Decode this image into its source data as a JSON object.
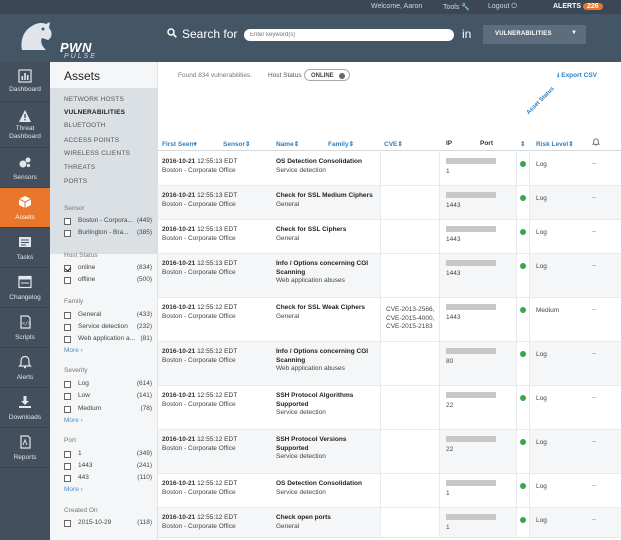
{
  "topbar": {
    "welcome": "Welcome, Aaron",
    "tools": "Tools",
    "logout": "Logout",
    "alerts_label": "ALERTS",
    "alerts_count": "226"
  },
  "brand": {
    "logo_main": "PWN",
    "logo_sub": "PULSE"
  },
  "search": {
    "label": "Search for",
    "placeholder": "Enter keyword(s)",
    "in_label": "in",
    "scope": "VULNERABILITIES"
  },
  "nav": [
    {
      "label": "Dashboard",
      "icon": "bar-chart-icon"
    },
    {
      "label": "Threat Dashboard",
      "icon": "warning-icon"
    },
    {
      "label": "Sensors",
      "icon": "sensors-icon"
    },
    {
      "label": "Assets",
      "icon": "cube-icon",
      "active": true
    },
    {
      "label": "Tasks",
      "icon": "tasks-icon"
    },
    {
      "label": "Changelog",
      "icon": "changelog-icon"
    },
    {
      "label": "Scripts",
      "icon": "script-icon"
    },
    {
      "label": "Alerts",
      "icon": "bell-icon"
    },
    {
      "label": "Downloads",
      "icon": "download-icon"
    },
    {
      "label": "Reports",
      "icon": "report-icon"
    }
  ],
  "assets": {
    "title": "Assets",
    "menu": [
      "NETWORK HOSTS",
      "VULNERABILITIES",
      "BLUETOOTH",
      "ACCESS POINTS",
      "WIRELESS CLIENTS",
      "THREATS",
      "PORTS"
    ],
    "selected": "VULNERABILITIES",
    "filters": {
      "sensor": {
        "title": "Sensor",
        "items": [
          {
            "name": "Boston - Corpora...",
            "count": "(449)",
            "checked": false
          },
          {
            "name": "Burlington - Bra...",
            "count": "(385)",
            "checked": false
          }
        ]
      },
      "host_status": {
        "title": "Host Status",
        "items": [
          {
            "name": "online",
            "count": "(834)",
            "checked": true
          },
          {
            "name": "offline",
            "count": "(500)",
            "checked": false
          }
        ]
      },
      "family": {
        "title": "Family",
        "items": [
          {
            "name": "General",
            "count": "(433)",
            "checked": false
          },
          {
            "name": "Service detection",
            "count": "(232)",
            "checked": false
          },
          {
            "name": "Web application a...",
            "count": "(81)",
            "checked": false
          }
        ],
        "more": "More"
      },
      "severity": {
        "title": "Severity",
        "items": [
          {
            "name": "Log",
            "count": "(614)",
            "checked": false
          },
          {
            "name": "Low",
            "count": "(141)",
            "checked": false
          },
          {
            "name": "Medium",
            "count": "(78)",
            "checked": false
          }
        ],
        "more": "More"
      },
      "port": {
        "title": "Port",
        "items": [
          {
            "name": "1",
            "count": "(349)",
            "checked": false
          },
          {
            "name": "1443",
            "count": "(241)",
            "checked": false
          },
          {
            "name": "443",
            "count": "(110)",
            "checked": false
          }
        ],
        "more": "More"
      },
      "created": {
        "title": "Created On",
        "items": [
          {
            "name": "2015-10-29",
            "count": "(118)",
            "checked": false
          }
        ]
      }
    }
  },
  "main": {
    "found": "Found 834 vulnerabilities.",
    "host_status_label": "Host Status",
    "host_status_value": "ONLINE",
    "export": "Export CSV",
    "asset_status_label": "Asset Status",
    "columns": {
      "first_seen": "First Seen",
      "sensor": "Sensor",
      "name": "Name",
      "family": "Family",
      "cve": "CVE",
      "ip": "IP",
      "port": "Port",
      "risk": "Risk Level"
    },
    "rows": [
      {
        "date": "2016-10-21",
        "time": "12:55:13 EDT",
        "sensor": "Boston - Corporate Office",
        "name": "OS Detection Consolidation",
        "family": "Service detection",
        "cve": "",
        "port": "1",
        "risk": "Log"
      },
      {
        "date": "2016-10-21",
        "time": "12:55:13 EDT",
        "sensor": "Boston - Corporate Office",
        "name": "Check for SSL Medium Ciphers",
        "family": "General",
        "cve": "",
        "port": "1443",
        "risk": "Log"
      },
      {
        "date": "2016-10-21",
        "time": "12:55:13 EDT",
        "sensor": "Boston - Corporate Office",
        "name": "Check for SSL Ciphers",
        "family": "General",
        "cve": "",
        "port": "1443",
        "risk": "Log"
      },
      {
        "date": "2016-10-21",
        "time": "12:55:13 EDT",
        "sensor": "Boston - Corporate Office",
        "name": "Info / Options concerning CGI Scanning",
        "family": "Web application abuses",
        "cve": "",
        "port": "1443",
        "risk": "Log"
      },
      {
        "date": "2016-10-21",
        "time": "12:55:12 EDT",
        "sensor": "Boston - Corporate Office",
        "name": "Check for SSL Weak Ciphers",
        "family": "General",
        "cve": "CVE-2013-2566, CVE-2015-4000, CVE-2015-2183",
        "port": "1443",
        "risk": "Medium"
      },
      {
        "date": "2016-10-21",
        "time": "12:55:12 EDT",
        "sensor": "Boston - Corporate Office",
        "name": "Info / Options concerning CGI Scanning",
        "family": "Web application abuses",
        "cve": "",
        "port": "80",
        "risk": "Log"
      },
      {
        "date": "2016-10-21",
        "time": "12:55:12 EDT",
        "sensor": "Boston - Corporate Office",
        "name": "SSH Protocol Algorithms Supported",
        "family": "Service detection",
        "cve": "",
        "port": "22",
        "risk": "Log"
      },
      {
        "date": "2016-10-21",
        "time": "12:55:12 EDT",
        "sensor": "Boston - Corporate Office",
        "name": "SSH Protocol Versions Supported",
        "family": "Service detection",
        "cve": "",
        "port": "22",
        "risk": "Log"
      },
      {
        "date": "2016-10-21",
        "time": "12:55:12 EDT",
        "sensor": "Boston - Corporate Office",
        "name": "OS Detection Consolidation",
        "family": "Service detection",
        "cve": "",
        "port": "1",
        "risk": "Log"
      },
      {
        "date": "2016-10-21",
        "time": "12:55:12 EDT",
        "sensor": "Boston - Corporate Office",
        "name": "Check open ports",
        "family": "General",
        "cve": "",
        "port": "1",
        "risk": "Log"
      }
    ]
  },
  "colors": {
    "accent": "#e8762b",
    "link": "#2d7fc1",
    "header": "#445566",
    "nav": "#434f5c",
    "online": "#3ea34a"
  }
}
